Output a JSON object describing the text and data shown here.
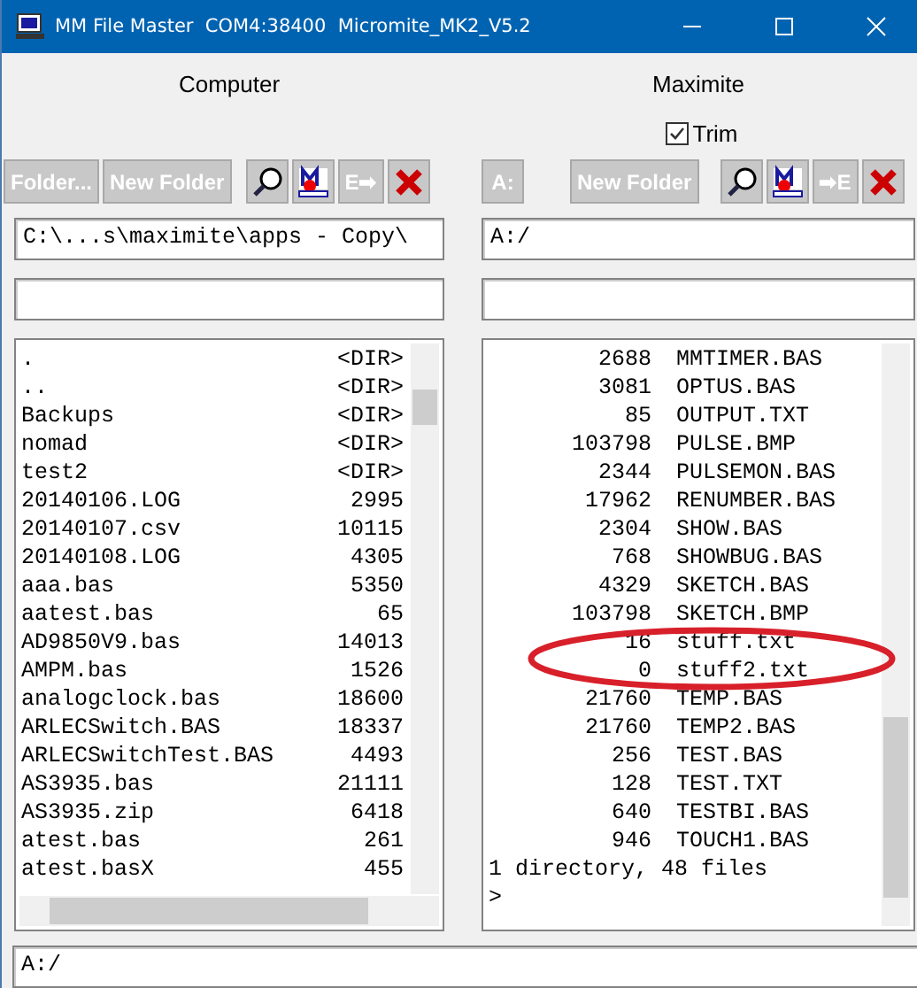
{
  "window": {
    "title": "MM File Master  COM4:38400  Micromite_MK2_V5.2"
  },
  "computer": {
    "heading": "Computer",
    "buttons": [
      {
        "kind": "text",
        "label": "Folder..."
      },
      {
        "kind": "text",
        "label": "New Folder"
      },
      {
        "kind": "search"
      },
      {
        "kind": "mm"
      },
      {
        "kind": "text",
        "label": "E➡"
      },
      {
        "kind": "delete"
      }
    ],
    "path": "C:\\...s\\maximite\\apps - Copy\\",
    "files": [
      {
        "name": ".",
        "size": "<DIR>"
      },
      {
        "name": "..",
        "size": "<DIR>"
      },
      {
        "name": "Backups",
        "size": "<DIR>"
      },
      {
        "name": "nomad",
        "size": "<DIR>"
      },
      {
        "name": "test2",
        "size": "<DIR>"
      },
      {
        "name": "20140106.LOG",
        "size": "2995"
      },
      {
        "name": "20140107.csv",
        "size": "10115"
      },
      {
        "name": "20140108.LOG",
        "size": "4305"
      },
      {
        "name": "aaa.bas",
        "size": "5350"
      },
      {
        "name": "aatest.bas",
        "size": "65"
      },
      {
        "name": "AD9850V9.bas",
        "size": "14013"
      },
      {
        "name": "AMPM.bas",
        "size": "1526"
      },
      {
        "name": "analogclock.bas",
        "size": "18600"
      },
      {
        "name": "ARLECSwitch.BAS",
        "size": "18337"
      },
      {
        "name": "ARLECSwitchTest.BAS",
        "size": "4493"
      },
      {
        "name": "AS3935.bas",
        "size": "21111"
      },
      {
        "name": "AS3935.zip",
        "size": "6418"
      },
      {
        "name": "atest.bas",
        "size": "261"
      },
      {
        "name": "atest.basX",
        "size": "455"
      }
    ]
  },
  "maximite": {
    "heading": "Maximite",
    "trim": {
      "label": "Trim",
      "checked": true
    },
    "buttons": [
      {
        "kind": "text",
        "label": "A:"
      },
      {
        "kind": "text",
        "label": "New Folder"
      },
      {
        "kind": "search"
      },
      {
        "kind": "mm"
      },
      {
        "kind": "text",
        "label": "➡E"
      },
      {
        "kind": "delete"
      }
    ],
    "path": "A:/",
    "files": [
      {
        "size": "2688",
        "name": "MMTIMER.BAS"
      },
      {
        "size": "3081",
        "name": "OPTUS.BAS"
      },
      {
        "size": "85",
        "name": "OUTPUT.TXT"
      },
      {
        "size": "103798",
        "name": "PULSE.BMP"
      },
      {
        "size": "2344",
        "name": "PULSEMON.BAS"
      },
      {
        "size": "17962",
        "name": "RENUMBER.BAS"
      },
      {
        "size": "2304",
        "name": "SHOW.BAS"
      },
      {
        "size": "768",
        "name": "SHOWBUG.BAS"
      },
      {
        "size": "4329",
        "name": "SKETCH.BAS"
      },
      {
        "size": "103798",
        "name": "SKETCH.BMP"
      },
      {
        "size": "16",
        "name": "stuff.txt"
      },
      {
        "size": "0",
        "name": "stuff2.txt"
      },
      {
        "size": "21760",
        "name": "TEMP.BAS"
      },
      {
        "size": "21760",
        "name": "TEMP2.BAS"
      },
      {
        "size": "256",
        "name": "TEST.BAS"
      },
      {
        "size": "128",
        "name": "TEST.TXT"
      },
      {
        "size": "640",
        "name": "TESTBI.BAS"
      },
      {
        "size": "946",
        "name": "TOUCH1.BAS"
      }
    ],
    "console": [
      "1 directory, 48 files",
      ">"
    ]
  },
  "command": {
    "value": "A:/"
  }
}
